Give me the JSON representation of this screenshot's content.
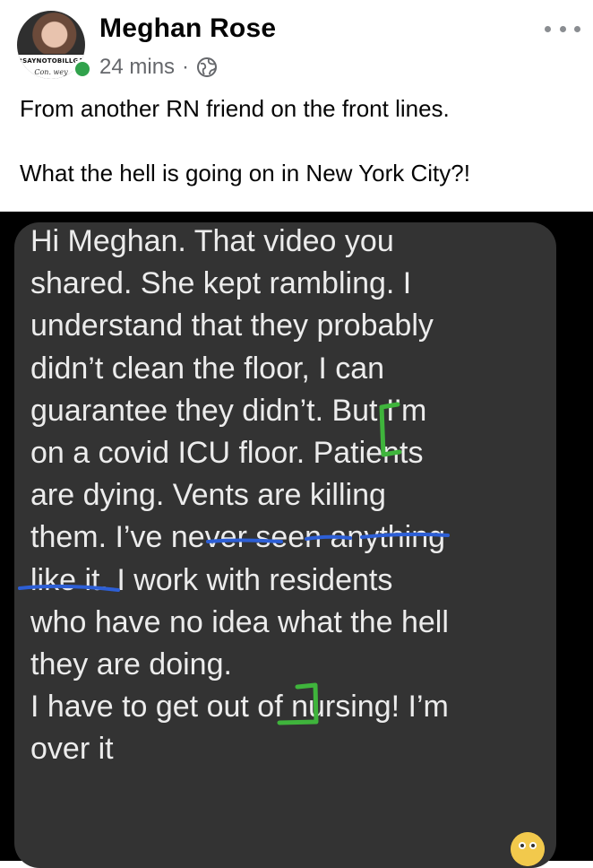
{
  "post": {
    "author": "Meghan Rose",
    "time": "24 mins",
    "separator": "·",
    "visibility_icon": "globe-icon",
    "more_icon": "more-icon",
    "text_line_1": "From another RN friend on the front lines.",
    "text_line_2": "What the hell is going on in New York City?!"
  },
  "avatar": {
    "banner": "#SAYNOTOBILLGATES",
    "signature": "Con. wey"
  },
  "message": {
    "text": "Hi Meghan. That video you\nshared. She kept rambling. I\nunderstand that they probably\ndidn’t clean the floor, I can\nguarantee they didn’t. But I’m\non a covid ICU floor. Patients\nare dying. Vents are killing\nthem. I’ve never seen anything\nlike it. I work with residents\nwho have no idea what the hell\nthey are doing.\nI have to get out of nursing! I’m\nover it"
  },
  "colors": {
    "online": "#31a24c",
    "bubble": "#333333",
    "annotation_green": "#3fb43c",
    "annotation_blue": "#2d5fd6",
    "meta_gray": "#65676b"
  },
  "reaction_icon": "astonished-emoji-icon"
}
